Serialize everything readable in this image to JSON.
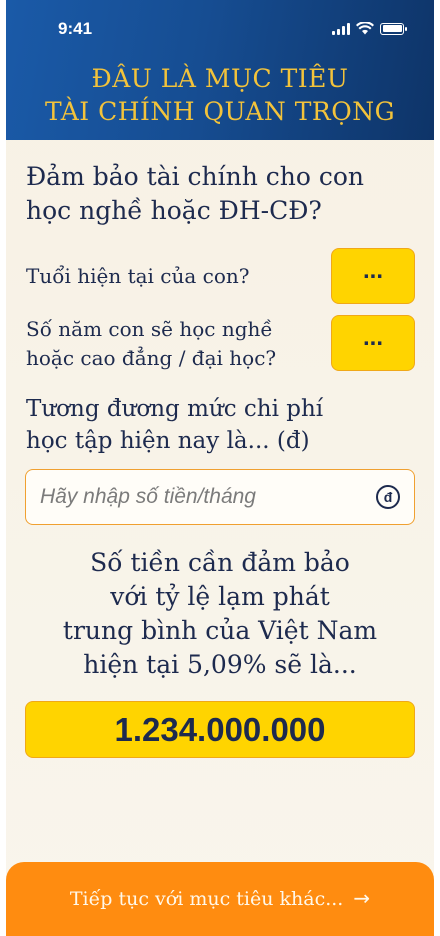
{
  "status": {
    "time": "9:41",
    "icons": [
      "signal-icon",
      "wifi-icon",
      "battery-icon"
    ]
  },
  "header": {
    "title_line1": "ĐÂU LÀ MỤC TIÊU",
    "title_line2": "TÀI CHÍNH QUAN TRỌNG"
  },
  "form": {
    "section_title_line1": "Đảm bảo tài chính cho con",
    "section_title_line2": "học nghề hoặc ĐH-CĐ?",
    "age_question": "Tuổi hiện tại của con?",
    "age_value": "...",
    "years_question_line1": "Số năm con sẽ học nghề",
    "years_question_line2": "hoặc cao đẳng / đại học?",
    "years_value": "...",
    "cost_label_line1": "Tương đương mức chi phí",
    "cost_label_line2": "học tập hiện nay là... (đ)",
    "money_placeholder": "Hãy nhập số tiền/tháng",
    "currency_icon": "dong-currency-icon"
  },
  "result": {
    "line1": "Số tiền cần đảm bảo",
    "line2": "với tỷ lệ lạm phát",
    "line3": "trung bình của Việt Nam",
    "line4": "hiện tại 5,09% sẽ là...",
    "amount": "1.234.000.000"
  },
  "footer": {
    "continue_label": "Tiếp tục với mục tiêu khác...",
    "arrow": "→"
  },
  "colors": {
    "header_blue": "#164d92",
    "gold_text": "#f3c33b",
    "yellow": "#ffd400",
    "orange": "#ff8c10",
    "navy_text": "#1d2a4e"
  }
}
